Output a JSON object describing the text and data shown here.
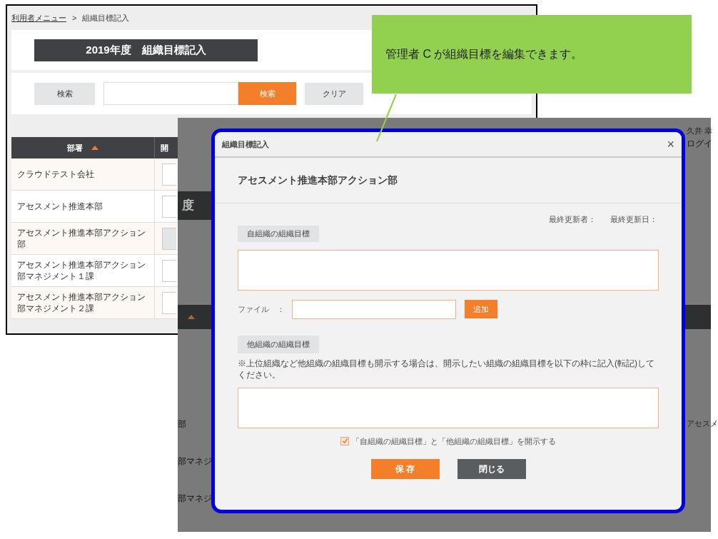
{
  "back_screen": {
    "breadcrumb": {
      "link": "利用者メニュー",
      "separator": ">",
      "current": "組織目標記入"
    },
    "title": "2019年度　組織目標記入",
    "search": {
      "label": "検索",
      "button": "検索",
      "clear": "クリア"
    },
    "table": {
      "columns": [
        {
          "label": "部署",
          "sorted": true
        },
        {
          "label": "開",
          "sorted": false
        }
      ],
      "rows": [
        {
          "name": "クラウドテスト会社",
          "field_disabled": false
        },
        {
          "name": "アセスメント推進本部",
          "field_disabled": false
        },
        {
          "name": "アセスメント推進本部アクション部",
          "field_disabled": true
        },
        {
          "name": "アセスメント推進本部アクション部マネジメント１課",
          "field_disabled": false
        },
        {
          "name": "アセスメント推進本部アクション部マネジメント２課",
          "field_disabled": false
        }
      ]
    }
  },
  "middle_screen": {
    "title_fragment": "度",
    "user_name": "久井 幸",
    "login_link": "ログイ",
    "row_fragments": [
      "部",
      "部マネジ",
      "部マネジ"
    ],
    "right_fragment": "アセスメ"
  },
  "dialog": {
    "title": "組織目標記入",
    "close": "×",
    "department": "アセスメント推進本部アクション部",
    "last_updated_by": "最終更新者：",
    "last_updated_on": "最終更新日：",
    "own_section": "自組織の組織目標",
    "file_label": "ファイル　：",
    "add_button": "追加",
    "other_section": "他組織の組織目標",
    "note": "※上位組織など他組織の組織目標も開示する場合は、開示したい組織の組織目標を以下の枠に記入(転記)してください。",
    "disclose": {
      "label": "「自組織の組織目標」と「他組織の組織目標」を開示する",
      "checked": true
    },
    "buttons": [
      {
        "label": "保 存",
        "kind": "primary"
      },
      {
        "label": "閉じる",
        "kind": "secondary"
      }
    ]
  },
  "callout": {
    "text": "管理者 C が組織目標を編集できます。"
  }
}
